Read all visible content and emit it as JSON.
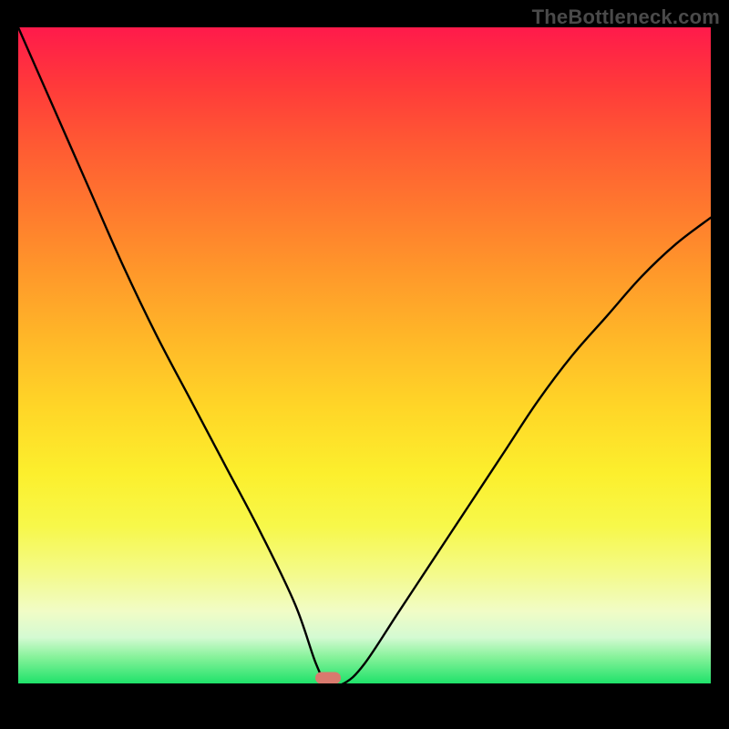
{
  "watermark": "TheBottleneck.com",
  "chart_data": {
    "type": "line",
    "title": "",
    "xlabel": "",
    "ylabel": "",
    "xlim": [
      0,
      1
    ],
    "ylim": [
      0,
      100
    ],
    "x": [
      0.0,
      0.05,
      0.1,
      0.15,
      0.2,
      0.25,
      0.3,
      0.35,
      0.4,
      0.43,
      0.447,
      0.47,
      0.5,
      0.55,
      0.6,
      0.65,
      0.7,
      0.75,
      0.8,
      0.85,
      0.9,
      0.95,
      1.0
    ],
    "values": [
      100,
      88,
      76,
      64,
      53,
      43,
      33,
      23,
      12,
      3,
      0,
      0,
      3,
      11,
      19,
      27,
      35,
      43,
      50,
      56,
      62,
      67,
      71
    ],
    "grid": false,
    "legend": false,
    "marker": {
      "x": 0.447,
      "y": 0,
      "color": "#d97a6e"
    },
    "background_gradient": {
      "direction": "top-to-bottom",
      "stops": [
        {
          "pos": 0.0,
          "color": "#ff1a4b"
        },
        {
          "pos": 0.5,
          "color": "#ffc327"
        },
        {
          "pos": 0.8,
          "color": "#f6f96a"
        },
        {
          "pos": 1.0,
          "color": "#1fe26a"
        }
      ]
    }
  }
}
